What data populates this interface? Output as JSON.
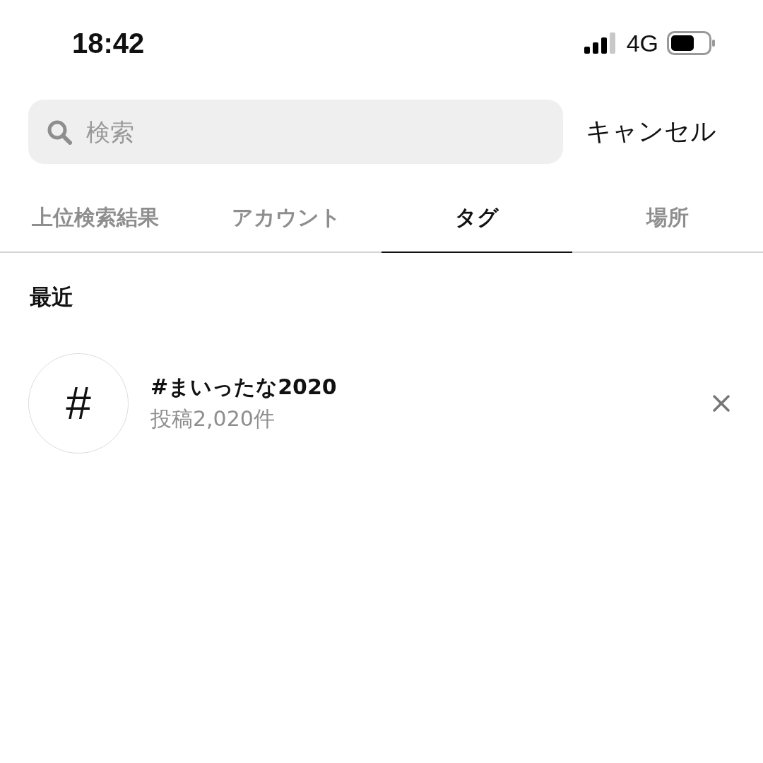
{
  "status_bar": {
    "time": "18:42",
    "network": "4G"
  },
  "search": {
    "placeholder": "検索",
    "cancel": "キャンセル"
  },
  "tabs": [
    {
      "label": "上位検索結果",
      "selected": false
    },
    {
      "label": "アカウント",
      "selected": false
    },
    {
      "label": "タグ",
      "selected": true
    },
    {
      "label": "場所",
      "selected": false
    }
  ],
  "recent": {
    "heading": "最近",
    "items": [
      {
        "icon": "#",
        "title": "#まいったな2020",
        "subtitle": "投稿2,020件"
      }
    ]
  }
}
